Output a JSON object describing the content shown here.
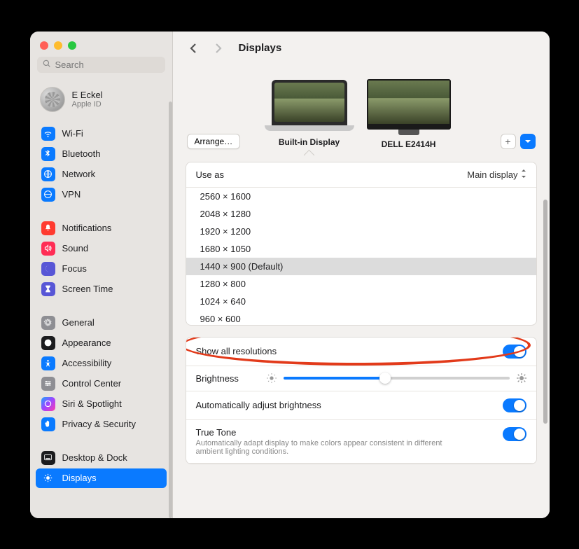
{
  "header": {
    "title": "Displays"
  },
  "search": {
    "placeholder": "Search"
  },
  "profile": {
    "name": "E Eckel",
    "sub": "Apple ID"
  },
  "sidebar": {
    "groups": [
      [
        {
          "label": "Wi-Fi",
          "color": "#0a7aff",
          "glyph": "wifi"
        },
        {
          "label": "Bluetooth",
          "color": "#0a7aff",
          "glyph": "bt"
        },
        {
          "label": "Network",
          "color": "#0a7aff",
          "glyph": "globe"
        },
        {
          "label": "VPN",
          "color": "#0a7aff",
          "glyph": "vpn"
        }
      ],
      [
        {
          "label": "Notifications",
          "color": "#ff3b30",
          "glyph": "bell"
        },
        {
          "label": "Sound",
          "color": "#ff2d55",
          "glyph": "sound"
        },
        {
          "label": "Focus",
          "color": "#5856d6",
          "glyph": "moon"
        },
        {
          "label": "Screen Time",
          "color": "#5856d6",
          "glyph": "hourglass"
        }
      ],
      [
        {
          "label": "General",
          "color": "#8e8e93",
          "glyph": "gear"
        },
        {
          "label": "Appearance",
          "color": "#1c1c1e",
          "glyph": "appearance"
        },
        {
          "label": "Accessibility",
          "color": "#0a7aff",
          "glyph": "access"
        },
        {
          "label": "Control Center",
          "color": "#8e8e93",
          "glyph": "sliders"
        },
        {
          "label": "Siri & Spotlight",
          "color": "linear-gradient(135deg,#1fa2ff,#a044ff,#ff3cac)",
          "glyph": "siri"
        },
        {
          "label": "Privacy & Security",
          "color": "#0a7aff",
          "glyph": "hand"
        }
      ],
      [
        {
          "label": "Desktop & Dock",
          "color": "#1c1c1e",
          "glyph": "dock"
        },
        {
          "label": "Displays",
          "color": "#0a7aff",
          "glyph": "sun",
          "selected": true
        }
      ]
    ]
  },
  "displays": {
    "arrange": "Arrange…",
    "items": [
      {
        "label": "Built-in Display",
        "active": true,
        "kind": "laptop"
      },
      {
        "label": "DELL E2414H",
        "active": false,
        "kind": "monitor"
      }
    ]
  },
  "panel": {
    "use_as_label": "Use as",
    "use_as_value": "Main display",
    "resolutions": [
      "2560 × 1600",
      "2048 × 1280",
      "1920 × 1200",
      "1680 × 1050",
      "1440 × 900 (Default)",
      "1280 × 800",
      "1024 × 640",
      "960 × 600"
    ],
    "resolution_selected_index": 4,
    "show_all_label": "Show all resolutions",
    "brightness_label": "Brightness",
    "auto_brightness_label": "Automatically adjust brightness",
    "true_tone_label": "True Tone",
    "true_tone_desc": "Automatically adapt display to make colors appear consistent in different ambient lighting conditions."
  }
}
